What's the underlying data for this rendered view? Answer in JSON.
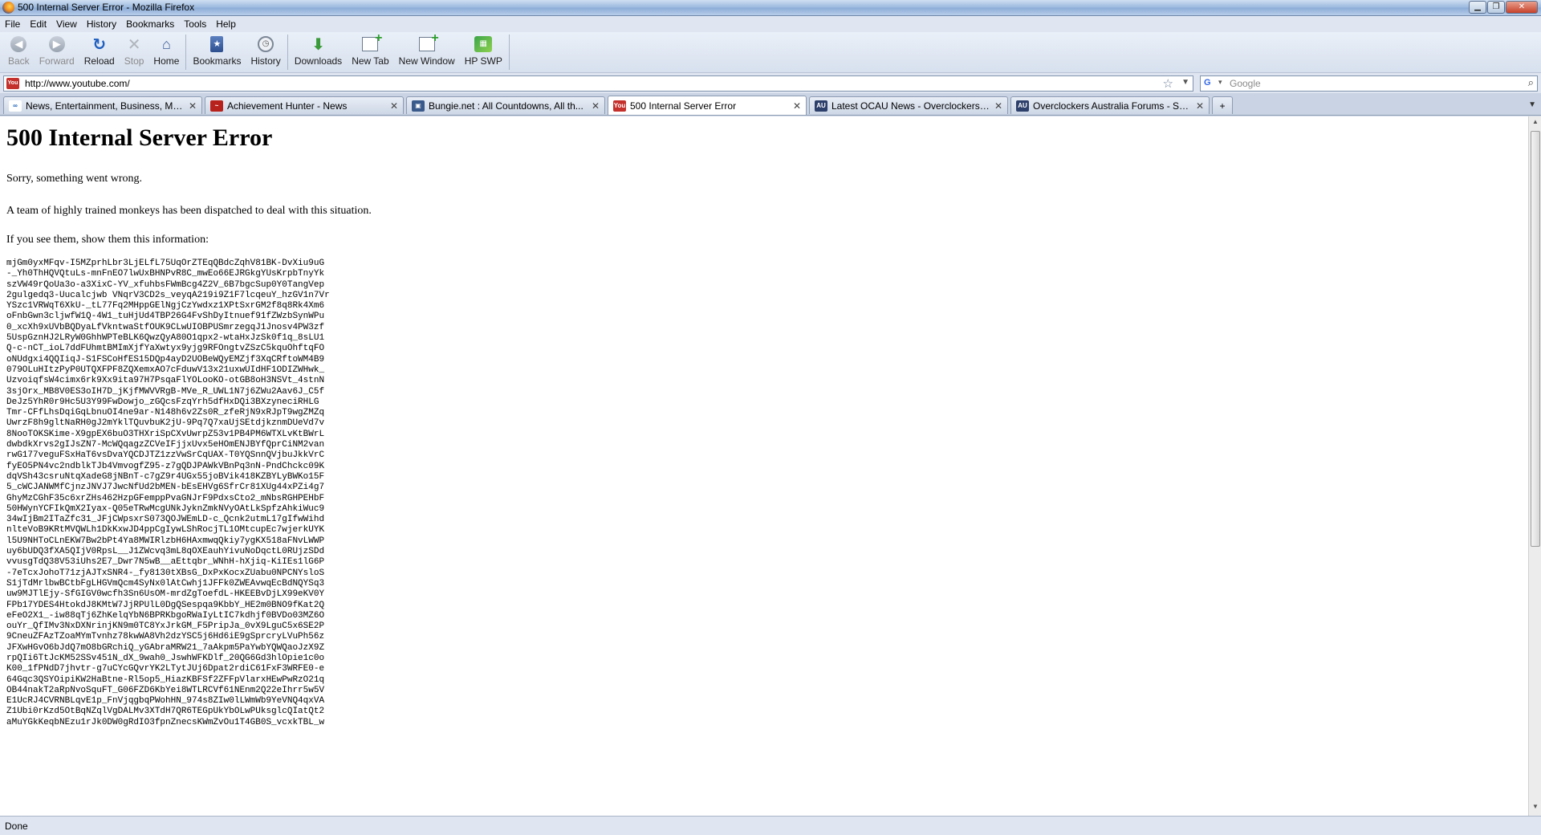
{
  "window": {
    "title": "500 Internal Server Error - Mozilla Firefox"
  },
  "menu": [
    "File",
    "Edit",
    "View",
    "History",
    "Bookmarks",
    "Tools",
    "Help"
  ],
  "toolbar": {
    "back": "Back",
    "forward": "Forward",
    "reload": "Reload",
    "stop": "Stop",
    "home": "Home",
    "bookmarks": "Bookmarks",
    "history": "History",
    "downloads": "Downloads",
    "new_tab": "New Tab",
    "new_window": "New Window",
    "hp_swp": "HP SWP"
  },
  "nav": {
    "url": "http://www.youtube.com/",
    "search_placeholder": "Google"
  },
  "tabs": [
    {
      "label": "News, Entertainment, Business, Mu...",
      "active": false
    },
    {
      "label": "Achievement Hunter - News",
      "active": false
    },
    {
      "label": "Bungie.net : All Countdowns, All th...",
      "active": false
    },
    {
      "label": "500 Internal Server Error",
      "active": true
    },
    {
      "label": "Latest OCAU News - Overclockers A...",
      "active": false
    },
    {
      "label": "Overclockers Australia Forums - Sea...",
      "active": false
    }
  ],
  "colors": {
    "youtube_red": "#c4302b",
    "chrome_blue": "#dfe6f1"
  },
  "page": {
    "heading": "500 Internal Server Error",
    "line1": "Sorry, something went wrong.",
    "line2": "A team of highly trained monkeys has been dispatched to deal with this situation.",
    "line3": "If you see them, show them this information:",
    "debug_text": "mjGm0yxMFqv-I5MZprhLbr3LjELfL75UqOrZTEqQBdcZqhV81BK-DvXiu9uG\n-_Yh0ThHQVQtuLs-mnFnEO7lwUxBHNPvR8C_mwEo66EJRGkgYUsKrpbTnyYk\nszVW49rQoUa3o-a3XixC-YV_xfuhbsFWmBcg4Z2V_6B7bgcSup0Y0TangVep\n2gulgedq3-Uucalcjwb VNqrV3CD2s_veyqA219i9Z1F7lcqeuY_hzGV1n7Vr\nYSzc1VRWqT6XkU-_tL77Fq2MHppGElNgjCzYwdxz1XPtSxrGM2f8q8Rk4Xm6\noFnbGwn3cljwfW1Q-4W1_tuHjUd4TBP26G4FvShDyItnuef91fZWzbSynWPu\n0_xcXh9xUVbBQDyaLfVkntwaStfOUK9CLwUIOBPUSmrzegqJ1Jnosv4PW3zf\n5UspGznHJ2LRyW0GhhWPTeBLK6QwzQyA80O1qpx2-wtaHxJzSk0f1q_8sLU1\nQ-c-nCT_ioL7ddFUhmtBMImXjfYaXwtyx9yjg9RFOngtvZSzC5kquOhftqFO\noNUdgxi4QQIiqJ-S1FSCoHfES15DQp4ayD2UOBeWQyEMZjf3XqCRftoWM4B9\n079OLuHItzPyP0UTQXFPF8ZQXemxAO7cFduwV13x21uxwUIdHF1ODIZWHwk_\nUzvoiqfsW4cimx6rk9Xx9ita97H7PsqaFlYOLooKO-otGB8oH3NSVt_4stnN\n3sjOrx_MB8V0ES3oIH7D_jKjfMWVVRgB-MVe_R_UWL1N7j6ZWu2Aav6J_C5f\nDeJz5YhR0r9Hc5U3Y99FwDowjo_zGQcsFzqYrh5dfHxDQi3BXzyneciRHLG\nTmr-CFfLhsDqiGqLbnuOI4ne9ar-N148h6v2Zs0R_zfeRjN9xRJpT9wgZMZq\nUwrzF8h9gltNaRH0gJ2mYklTQuvbuK2jU-9Pq7Q7xaUjSEtdjkznmDUeVd7v\n8NooTOKSKime-X9gpEX6buO3THXriSpCXvUwrpZ53v1PB4PM6WTXLvKtBWrL\ndwbdkXrvs2gIJsZN7-McWQqagzZCVeIFjjxUvx5eHOmENJBYfQprCiNM2van\nrwG177veguFSxHaT6vsDvaYQCDJTZ1zzVwSrCqUAX-T0YQSnnQVjbuJkkVrC\nfyEO5PN4vc2ndblkTJb4VmvogfZ95-z7gQDJPAWkVBnPq3nN-PndChckc09K\ndqVSh43csruNtqXadeG8jNBnT-c7gZ9r4UGx55joBVik418KZBYLyBWKo15F\n5_cWCJANWMfCjnzJNVJ7JwcNfUd2bMEN-bEsEHVg6SfrCr81XUg44xPZi4g7\nGhyMzCGhF35c6xrZHs462HzpGFemppPvaGNJrF9PdxsCto2_mNbsRGHPEHbF\n50HWynYCFIkQmX2Iyax-Q05eTRwMcgUNkJyknZmkNVyOAtLkSpfzAhkiWuc9\n34wIjBm2ITaZfc31_JFjCWpsxrS073QOJWEmLD-c_Qcnk2utmL17gIfwWihd\nnlteVoB9KRtMVQWLh1DkKxwJD4ppCgIywLShRocjTL1OMtcupEc7wjerkUYK\nl5U9NHToCLnEKW7Bw2bPt4Ya8MWIRlzbH6HAxmwqQkiy7ygKX518aFNvLWWP\nuy6bUDQ3fXA5QIjV0RpsL__J1ZWcvq3mL8qOXEauhYivuNoDqctL0RUjzSDd\nvvusgTdQ38V53iUhs2E7_Dwr7N5wB__aEttqbr_WNhH-hXjiq-KiIEs1lG6P\n-7eTcxJohoT71zjAJTxSNR4-_fy8130tXBsG_DxPxKocxZUabu0NPCNYsloS\nS1jTdMrlbwBCtbFgLHGVmQcm4SyNx0lAtCwhj1JFFk0ZWEAvwqEcBdNQYSq3\nuw9MJTlEjy-SfGIGV0wcfh3Sn6UsOM-mrdZgToefdL-HKEEBvDjLX99eKV0Y\nFPb17YDES4HtokdJ8KMtW7JjRPUlL0DgQSespqa9KbbY_HE2m0BNO9fKat2Q\neFeO2X1_-iw88qTj6ZhKelqYbN6BPRKbgoRWaIyLtIC7kdhjf0BVDo03MZ6O\nouYr_QfIMv3NxDXNrinjKN9m0TC8YxJrkGM_F5PripJa_0vX9LguC5x6SE2P\n9CneuZFAzTZoaMYmTvnhz78kwWA8Vh2dzYSC5j6Hd6iE9gSprcryLVuPh56z\nJFXwHGvO6bJdQ7mO8bGRchiQ_yGAbraMRW21_7aAkpm5PaYwbYQWQaoJzX9Z\nrpQIi6TtJcKM52SSv451N_dX_9wah0_JswhWFKDlf_20QG6Gd3hlOpie1c0o\nK00_1fPNdD7jhvtr-g7uCYcGQvrYK2LTytJUj6Dpat2rdiC61FxF3WRFE0-e\n64Gqc3QSYOipiKW2HaBtne-Rl5op5_HiazKBFSf2ZFFpVlarxHEwPwRzO21q\nOB44nakT2aRpNvoSquFT_G06FZD6KbYei8WTLRCVf61NEnm2Q22eIhrr5w5V\nE1UcRJ4CVRNBLqvE1p_FnVjqgbqPWohHN_974s8ZIw0lLWmWb9YeVNQ4qxVA\nZ1Ubi0rKzd5OtBqNZqlVgDALMv3XTdH7QR6TEGpUkYbOLwPUksglcQIatQt2\naMuYGkKeqbNEzu1rJk0DW0gRdIO3fpnZnecsKWmZvOu1T4GB0S_vcxkTBL_w"
  },
  "status": "Done"
}
